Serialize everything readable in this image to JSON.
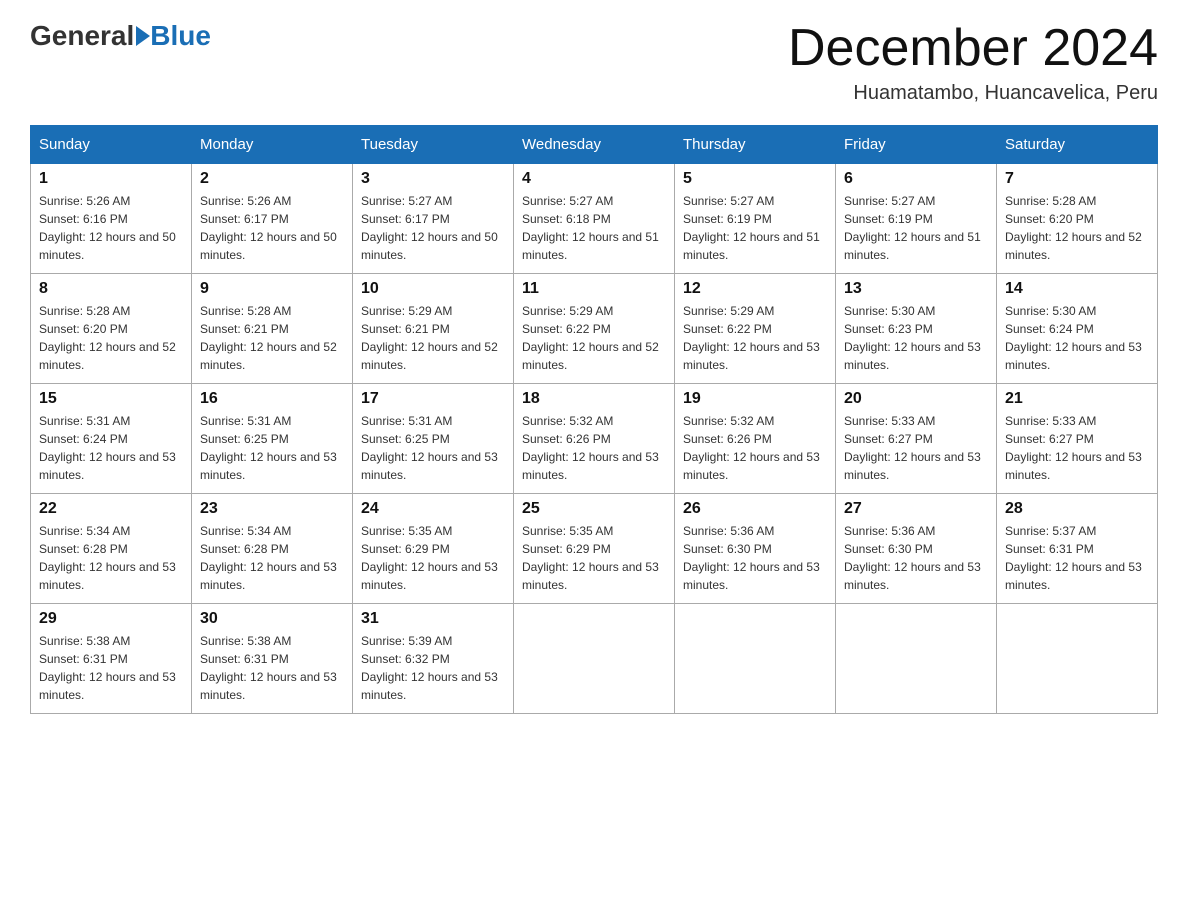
{
  "logo": {
    "general": "General",
    "blue": "Blue"
  },
  "title": "December 2024",
  "subtitle": "Huamatambo, Huancavelica, Peru",
  "headers": [
    "Sunday",
    "Monday",
    "Tuesday",
    "Wednesday",
    "Thursday",
    "Friday",
    "Saturday"
  ],
  "weeks": [
    [
      {
        "day": "1",
        "sunrise": "5:26 AM",
        "sunset": "6:16 PM",
        "daylight": "12 hours and 50 minutes."
      },
      {
        "day": "2",
        "sunrise": "5:26 AM",
        "sunset": "6:17 PM",
        "daylight": "12 hours and 50 minutes."
      },
      {
        "day": "3",
        "sunrise": "5:27 AM",
        "sunset": "6:17 PM",
        "daylight": "12 hours and 50 minutes."
      },
      {
        "day": "4",
        "sunrise": "5:27 AM",
        "sunset": "6:18 PM",
        "daylight": "12 hours and 51 minutes."
      },
      {
        "day": "5",
        "sunrise": "5:27 AM",
        "sunset": "6:19 PM",
        "daylight": "12 hours and 51 minutes."
      },
      {
        "day": "6",
        "sunrise": "5:27 AM",
        "sunset": "6:19 PM",
        "daylight": "12 hours and 51 minutes."
      },
      {
        "day": "7",
        "sunrise": "5:28 AM",
        "sunset": "6:20 PM",
        "daylight": "12 hours and 52 minutes."
      }
    ],
    [
      {
        "day": "8",
        "sunrise": "5:28 AM",
        "sunset": "6:20 PM",
        "daylight": "12 hours and 52 minutes."
      },
      {
        "day": "9",
        "sunrise": "5:28 AM",
        "sunset": "6:21 PM",
        "daylight": "12 hours and 52 minutes."
      },
      {
        "day": "10",
        "sunrise": "5:29 AM",
        "sunset": "6:21 PM",
        "daylight": "12 hours and 52 minutes."
      },
      {
        "day": "11",
        "sunrise": "5:29 AM",
        "sunset": "6:22 PM",
        "daylight": "12 hours and 52 minutes."
      },
      {
        "day": "12",
        "sunrise": "5:29 AM",
        "sunset": "6:22 PM",
        "daylight": "12 hours and 53 minutes."
      },
      {
        "day": "13",
        "sunrise": "5:30 AM",
        "sunset": "6:23 PM",
        "daylight": "12 hours and 53 minutes."
      },
      {
        "day": "14",
        "sunrise": "5:30 AM",
        "sunset": "6:24 PM",
        "daylight": "12 hours and 53 minutes."
      }
    ],
    [
      {
        "day": "15",
        "sunrise": "5:31 AM",
        "sunset": "6:24 PM",
        "daylight": "12 hours and 53 minutes."
      },
      {
        "day": "16",
        "sunrise": "5:31 AM",
        "sunset": "6:25 PM",
        "daylight": "12 hours and 53 minutes."
      },
      {
        "day": "17",
        "sunrise": "5:31 AM",
        "sunset": "6:25 PM",
        "daylight": "12 hours and 53 minutes."
      },
      {
        "day": "18",
        "sunrise": "5:32 AM",
        "sunset": "6:26 PM",
        "daylight": "12 hours and 53 minutes."
      },
      {
        "day": "19",
        "sunrise": "5:32 AM",
        "sunset": "6:26 PM",
        "daylight": "12 hours and 53 minutes."
      },
      {
        "day": "20",
        "sunrise": "5:33 AM",
        "sunset": "6:27 PM",
        "daylight": "12 hours and 53 minutes."
      },
      {
        "day": "21",
        "sunrise": "5:33 AM",
        "sunset": "6:27 PM",
        "daylight": "12 hours and 53 minutes."
      }
    ],
    [
      {
        "day": "22",
        "sunrise": "5:34 AM",
        "sunset": "6:28 PM",
        "daylight": "12 hours and 53 minutes."
      },
      {
        "day": "23",
        "sunrise": "5:34 AM",
        "sunset": "6:28 PM",
        "daylight": "12 hours and 53 minutes."
      },
      {
        "day": "24",
        "sunrise": "5:35 AM",
        "sunset": "6:29 PM",
        "daylight": "12 hours and 53 minutes."
      },
      {
        "day": "25",
        "sunrise": "5:35 AM",
        "sunset": "6:29 PM",
        "daylight": "12 hours and 53 minutes."
      },
      {
        "day": "26",
        "sunrise": "5:36 AM",
        "sunset": "6:30 PM",
        "daylight": "12 hours and 53 minutes."
      },
      {
        "day": "27",
        "sunrise": "5:36 AM",
        "sunset": "6:30 PM",
        "daylight": "12 hours and 53 minutes."
      },
      {
        "day": "28",
        "sunrise": "5:37 AM",
        "sunset": "6:31 PM",
        "daylight": "12 hours and 53 minutes."
      }
    ],
    [
      {
        "day": "29",
        "sunrise": "5:38 AM",
        "sunset": "6:31 PM",
        "daylight": "12 hours and 53 minutes."
      },
      {
        "day": "30",
        "sunrise": "5:38 AM",
        "sunset": "6:31 PM",
        "daylight": "12 hours and 53 minutes."
      },
      {
        "day": "31",
        "sunrise": "5:39 AM",
        "sunset": "6:32 PM",
        "daylight": "12 hours and 53 minutes."
      },
      null,
      null,
      null,
      null
    ]
  ],
  "labels": {
    "sunrise": "Sunrise:",
    "sunset": "Sunset:",
    "daylight": "Daylight:"
  }
}
